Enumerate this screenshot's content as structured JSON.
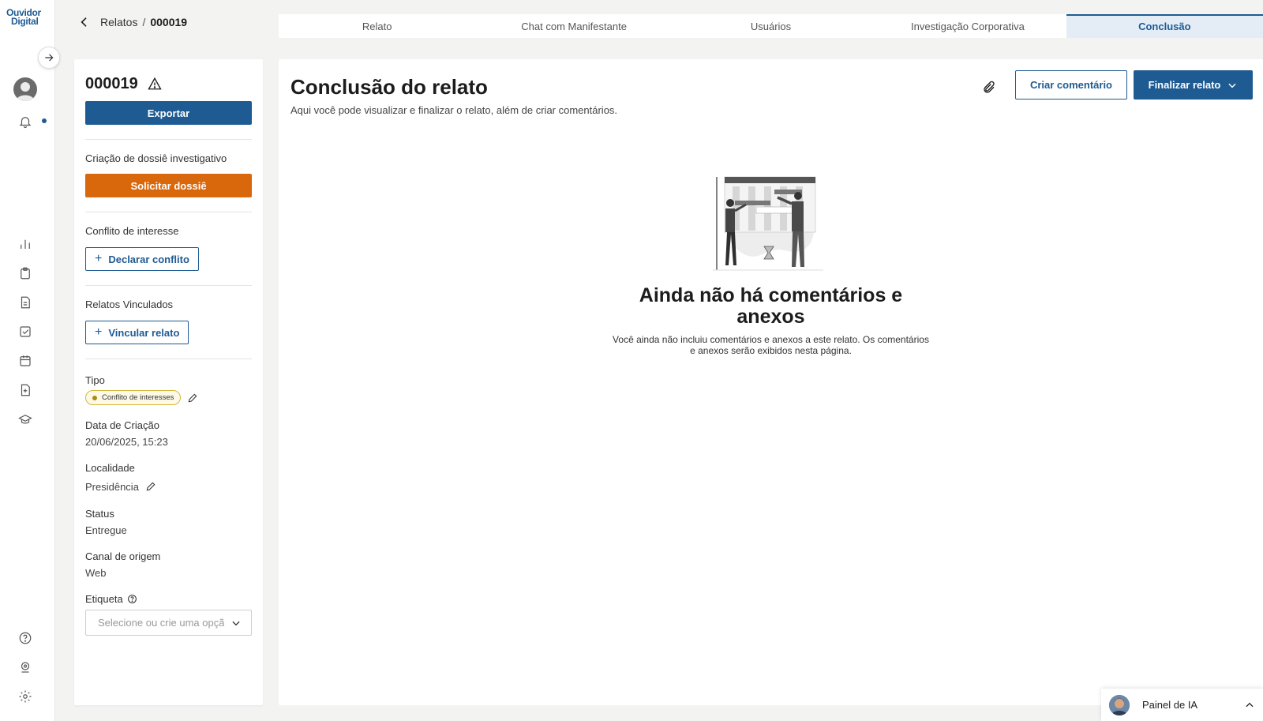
{
  "logo": {
    "line1": "Ouvidor",
    "line2": "Digital"
  },
  "rail": {
    "icons": [
      "arrow-right-icon",
      "user-avatar-icon",
      "bell-icon",
      "bar-chart-icon",
      "clipboard-icon",
      "document-icon",
      "checklist-icon",
      "calendar-icon",
      "file-plus-icon",
      "graduation-cap-icon",
      "help-circle-icon",
      "location-icon",
      "settings-icon"
    ]
  },
  "breadcrumb": {
    "parent": "Relatos",
    "separator": "/",
    "current": "000019"
  },
  "tabs": [
    {
      "label": "Relato",
      "active": false
    },
    {
      "label": "Chat com Manifestante",
      "active": false
    },
    {
      "label": "Usuários",
      "active": false
    },
    {
      "label": "Investigação Corporativa",
      "active": false
    },
    {
      "label": "Conclusão",
      "active": true
    }
  ],
  "side": {
    "report_id": "000019",
    "export_label": "Exportar",
    "dossie_label": "Criação de dossiê investigativo",
    "dossie_button": "Solicitar dossiê",
    "conflict_label": "Conflito de interesse",
    "conflict_button": "Declarar conflito",
    "linked_label": "Relatos Vinculados",
    "linked_button": "Vincular relato",
    "fields": {
      "tipo_label": "Tipo",
      "tipo_value": "Conflito de interesses",
      "criacao_label": "Data de Criação",
      "criacao_value": "20/06/2025, 15:23",
      "localidade_label": "Localidade",
      "localidade_value": "Presidência",
      "status_label": "Status",
      "status_value": "Entregue",
      "canal_label": "Canal de origem",
      "canal_value": "Web",
      "etiqueta_label": "Etiqueta",
      "etiqueta_placeholder": "Selecione ou crie uma opção"
    }
  },
  "main": {
    "title": "Conclusão do relato",
    "subtitle": "Aqui você pode visualizar e finalizar o relato, além de criar comentários.",
    "comment_button": "Criar comentário",
    "finalize_button": "Finalizar relato",
    "empty_title": "Ainda não há comentários e anexos",
    "empty_text": "Você ainda não incluiu comentários e anexos a este relato. Os comentários e anexos serão exibidos nesta página."
  },
  "ai_panel": {
    "label": "Painel de IA"
  },
  "colors": {
    "primary": "#1e5b93",
    "accent": "#d9670b",
    "tag_border": "#d2b640"
  }
}
